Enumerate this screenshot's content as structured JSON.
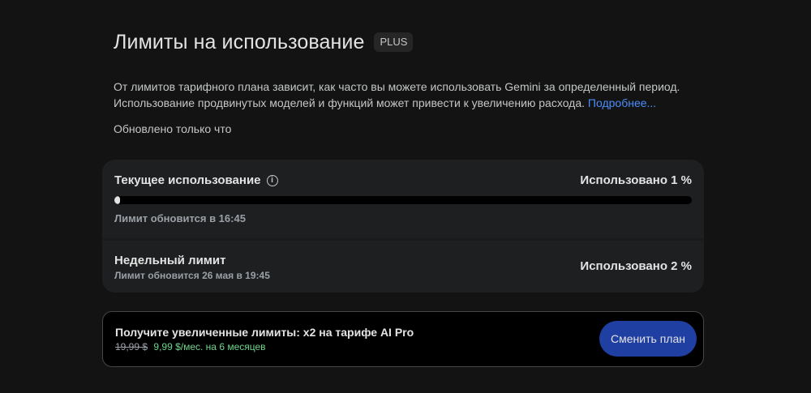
{
  "header": {
    "title": "Лимиты на использование",
    "plan_badge": "PLUS"
  },
  "description": {
    "text": "От лимитов тарифного плана зависит, как часто вы можете использовать Gemini за определенный период. Использование продвинутых моделей и функций может привести к увеличению расхода.",
    "link_label": "Подробнее..."
  },
  "updated_text": "Обновлено только что",
  "current_usage": {
    "title": "Текущее использование",
    "info_icon": "info-icon",
    "value_label": "Использовано 1 %",
    "progress_fraction": 0.01,
    "reset_text": "Лимит обновится в 16:45"
  },
  "weekly_limit": {
    "title": "Недельный лимит",
    "value_label": "Использовано 2 %",
    "reset_text": "Лимит обновится 26 мая в 19:45"
  },
  "upsell": {
    "title": "Получите увеличенные лимиты: x2 на тарифе AI Pro",
    "old_price": "19,99 $",
    "new_price": "9,99 $/мес. на 6 месяцев",
    "button_label": "Сменить план"
  },
  "colors": {
    "background": "#131314",
    "card": "#1e1f20",
    "link": "#4b8df8",
    "price_accent": "#6dd58c",
    "button": "#1f3fa3"
  }
}
